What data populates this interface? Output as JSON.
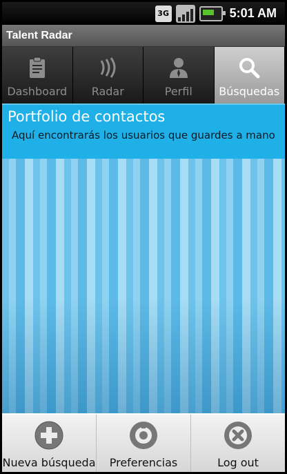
{
  "status_bar": {
    "network": "3G",
    "time": "5:01 AM"
  },
  "app": {
    "title": "Talent Radar"
  },
  "tabs": [
    {
      "label": "Dashboard",
      "icon": "clipboard-icon",
      "active": false
    },
    {
      "label": "Radar",
      "icon": "radar-waves-icon",
      "active": false
    },
    {
      "label": "Perfil",
      "icon": "person-icon",
      "active": false
    },
    {
      "label": "Búsquedas",
      "icon": "search-icon",
      "active": true
    }
  ],
  "header": {
    "title": "Portfolio de contactos",
    "subtitle": "Aquí encontrarás los usuarios que guardes a mano"
  },
  "bottom_bar": [
    {
      "label": "Nueva búsqueda",
      "icon": "plus-icon"
    },
    {
      "label": "Preferencias",
      "icon": "gear-icon"
    },
    {
      "label": "Log out",
      "icon": "close-icon"
    }
  ],
  "colors": {
    "accent": "#1fb0e7",
    "tab_active": "#bdbdbd"
  }
}
